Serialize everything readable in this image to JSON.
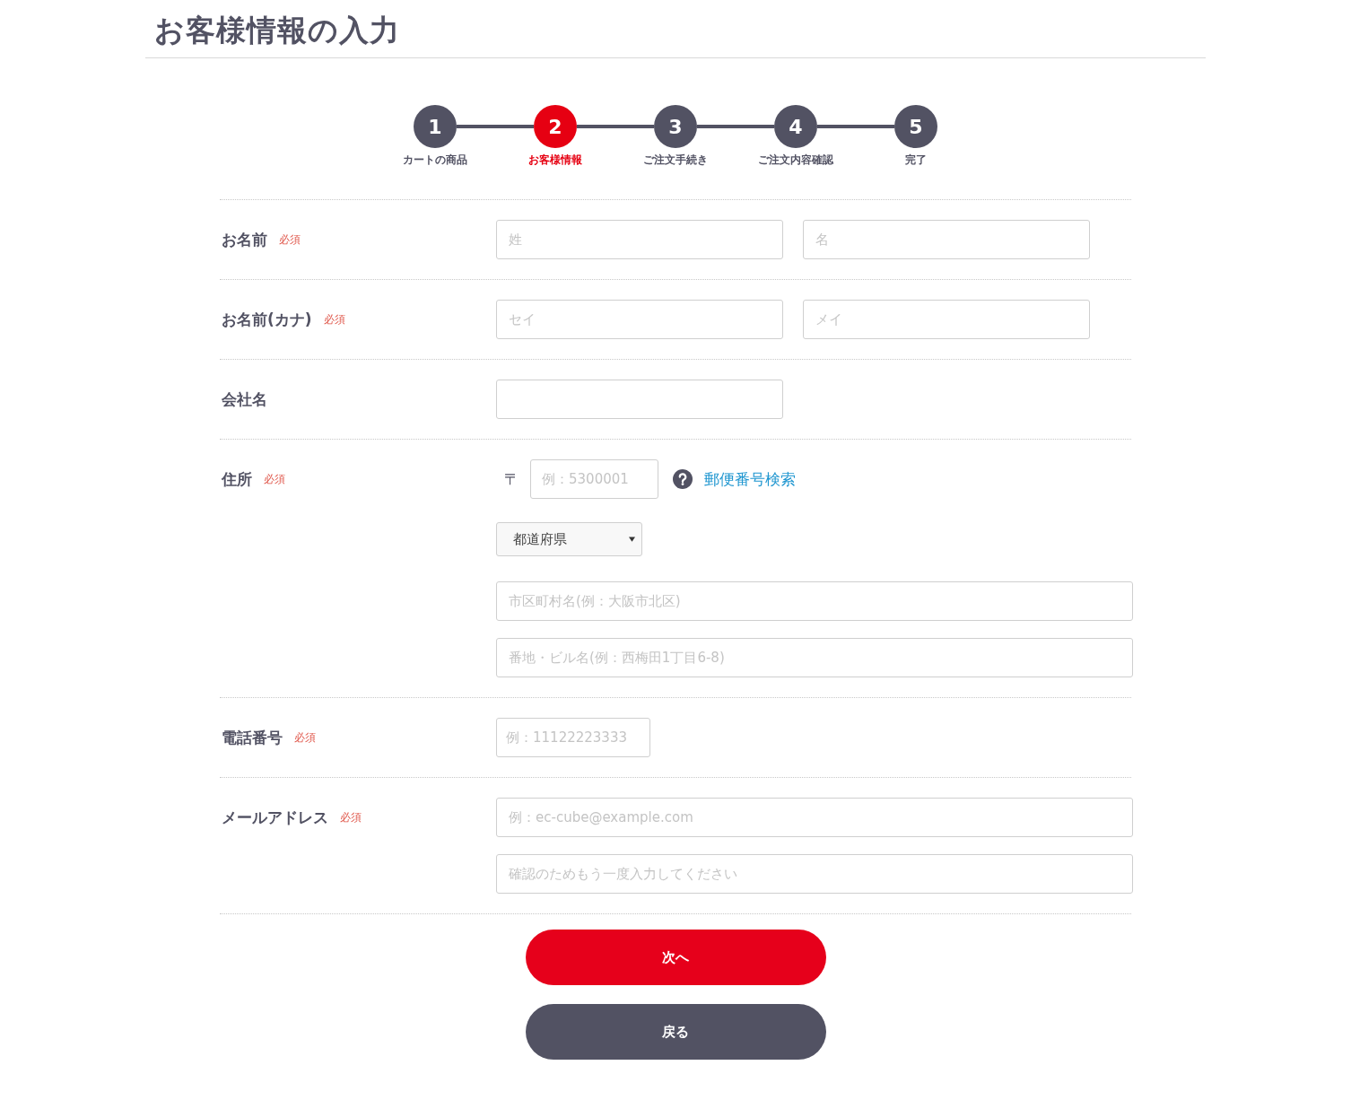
{
  "page_title": "お客様情報の入力",
  "steps": [
    {
      "number": "1",
      "label": "カートの商品",
      "selected": false
    },
    {
      "number": "2",
      "label": "お客様情報",
      "selected": true
    },
    {
      "number": "3",
      "label": "ご注文手続き",
      "selected": false
    },
    {
      "number": "4",
      "label": "ご注文内容確認",
      "selected": false
    },
    {
      "number": "5",
      "label": "完了",
      "selected": false
    }
  ],
  "form": {
    "rows": [
      {
        "label": "お名前",
        "required_mark": "必須",
        "fields": [
          {
            "kind": "half",
            "placeholder": "姓"
          },
          {
            "kind": "half",
            "placeholder": "名"
          }
        ]
      },
      {
        "label": "お名前(カナ)",
        "required_mark": "必須",
        "fields": [
          {
            "kind": "half",
            "placeholder": "セイ"
          },
          {
            "kind": "half",
            "placeholder": "メイ"
          }
        ]
      },
      {
        "label": "会社名",
        "fields": [
          {
            "kind": "half"
          }
        ]
      },
      {
        "label": "住所",
        "required_mark": "必須",
        "fields": [
          {
            "kind": "postal",
            "prefix": "〒",
            "placeholder": "例：5300001",
            "link": "郵便番号検索"
          },
          {
            "kind": "select",
            "value": "都道府県"
          },
          {
            "kind": "full",
            "placeholder": "市区町村名(例：大阪市北区)"
          },
          {
            "kind": "full",
            "placeholder": "番地・ビル名(例：西梅田1丁目6-8)"
          }
        ]
      },
      {
        "label": "電話番号",
        "required_mark": "必須",
        "fields": [
          {
            "kind": "short",
            "placeholder": "例：11122223333"
          }
        ]
      },
      {
        "label": "メールアドレス",
        "required_mark": "必須",
        "fields": [
          {
            "kind": "full",
            "placeholder": "例：ec-cube@example.com"
          },
          {
            "kind": "full",
            "placeholder": "確認のためもう一度入力してください"
          }
        ]
      }
    ]
  },
  "buttons": [
    {
      "kind": "primary",
      "label": "次へ"
    },
    {
      "kind": "secondary",
      "label": "戻る"
    }
  ]
}
